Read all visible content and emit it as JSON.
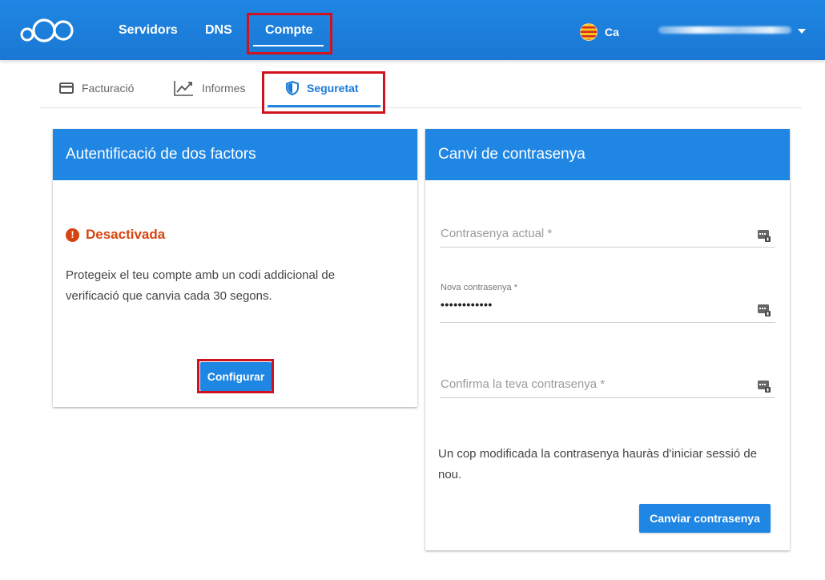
{
  "header": {
    "nav": [
      {
        "label": "Servidors"
      },
      {
        "label": "DNS"
      },
      {
        "label": "Compte"
      }
    ],
    "language": {
      "label": "Ca",
      "flag": "catalan-flag-icon"
    },
    "user_menu": {
      "icon": "chevron-down-icon"
    }
  },
  "subtabs": [
    {
      "label": "Facturació",
      "icon": "credit-card-icon"
    },
    {
      "label": "Informes",
      "icon": "line-chart-icon"
    },
    {
      "label": "Seguretat",
      "icon": "shield-icon",
      "active": true
    }
  ],
  "two_factor": {
    "title": "Autentificació de dos factors",
    "status_icon": "alert-circle-icon",
    "status": "Desactivada",
    "description": "Protegeix el teu compte amb un codi addicional de verificació que canvia cada 30 segons.",
    "button": "Configurar"
  },
  "password": {
    "title": "Canvi de contrasenya",
    "current_placeholder": "Contrasenya actual *",
    "new_label": "Nova contrasenya *",
    "new_value": "••••••••••••",
    "confirm_placeholder": "Confirma la teva contrasenya *",
    "field_icon": "password-key-icon",
    "note": "Un cop modificada la contrasenya hauràs d'iniciar sessió de nou.",
    "button": "Canviar contrasenya"
  },
  "colors": {
    "primary": "#1f86e3",
    "warning": "#d64511",
    "highlight": "#d0121e"
  }
}
